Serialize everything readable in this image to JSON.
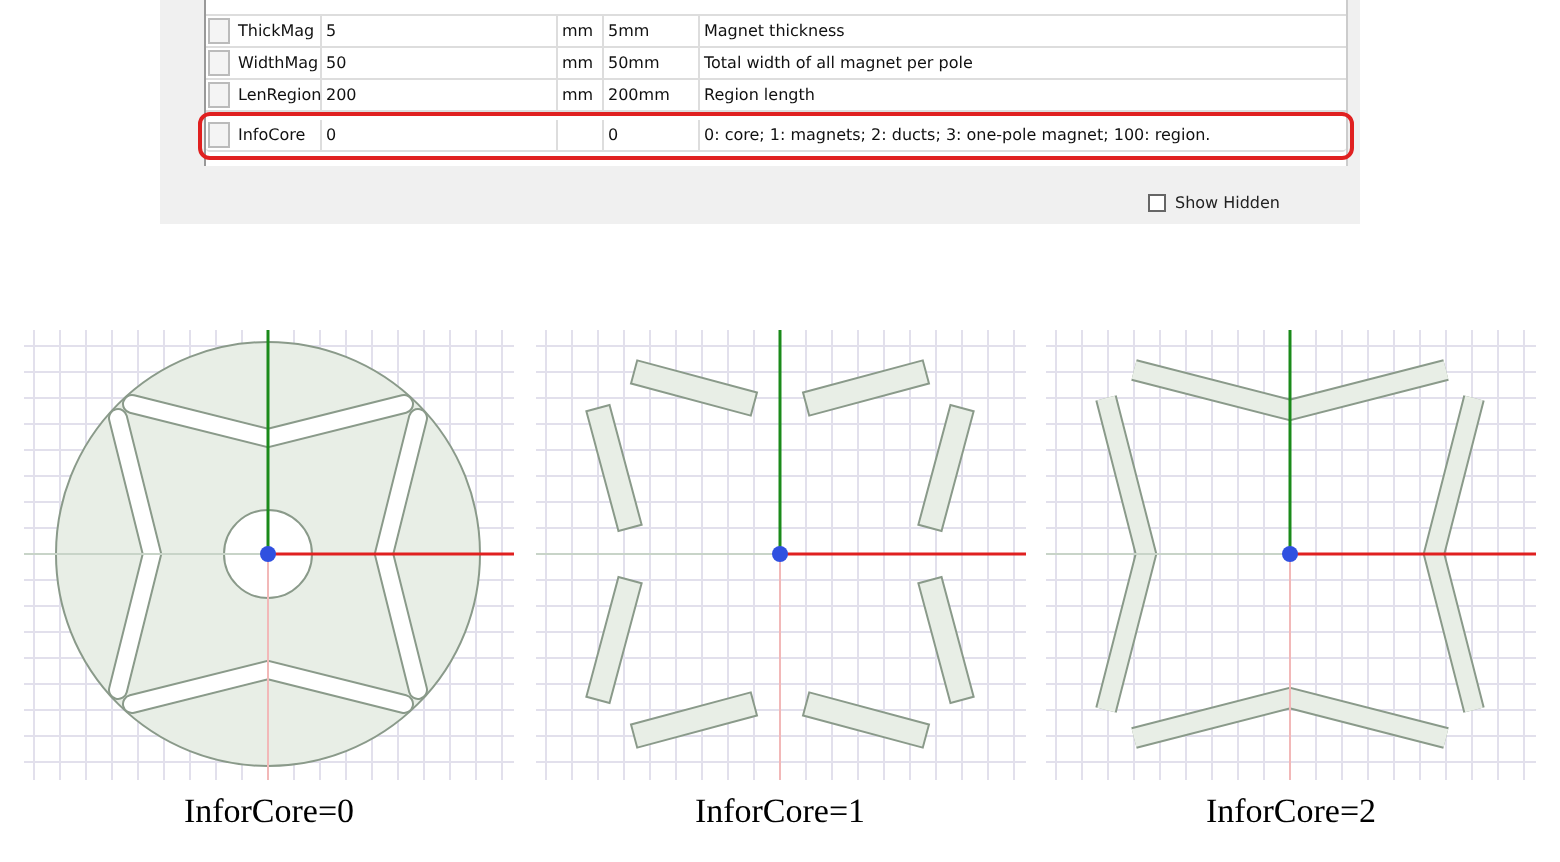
{
  "properties_table": {
    "rows": [
      {
        "name": "ThickMag",
        "value": "5",
        "unit": "mm",
        "evaluated": "5mm",
        "description": "Magnet thickness",
        "highlighted": false
      },
      {
        "name": "WidthMag",
        "value": "50",
        "unit": "mm",
        "evaluated": "50mm",
        "description": "Total width of all magnet per pole",
        "highlighted": false
      },
      {
        "name": "LenRegion",
        "value": "200",
        "unit": "mm",
        "evaluated": "200mm",
        "description": "Region length",
        "highlighted": false
      },
      {
        "name": "InfoCore",
        "value": "0",
        "unit": "",
        "evaluated": "0",
        "description": "0: core; 1: magnets; 2: ducts; 3: one-pole magnet; 100: region.",
        "highlighted": true
      }
    ]
  },
  "show_hidden": {
    "label": "Show Hidden",
    "checked": false
  },
  "figures": [
    {
      "kind": "core",
      "caption": "InforCore=0"
    },
    {
      "kind": "magnets",
      "caption": "InforCore=1"
    },
    {
      "kind": "ducts",
      "caption": "InforCore=2"
    }
  ]
}
